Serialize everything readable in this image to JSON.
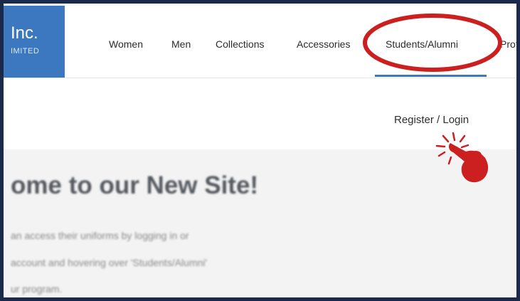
{
  "brand": {
    "name": "Inc.",
    "tagline": "IMITED"
  },
  "nav": {
    "items": [
      {
        "label": "Women"
      },
      {
        "label": "Men"
      },
      {
        "label": "Collections"
      },
      {
        "label": "Accessories"
      },
      {
        "label": "Students/Alumni"
      },
      {
        "label": "Prof"
      }
    ],
    "active_item": "Students/Alumni"
  },
  "account": {
    "register_login": "Register / Login"
  },
  "hero": {
    "headline": "ome to our New Site!",
    "lines": [
      "an access their uniforms by logging in or",
      "account and hovering over 'Students/Alumni'",
      "ur program."
    ]
  },
  "annotations": {
    "highlight_target": "Students/Alumni",
    "pointer_target": "Register / Login",
    "highlight_color": "#cc1f1f"
  }
}
